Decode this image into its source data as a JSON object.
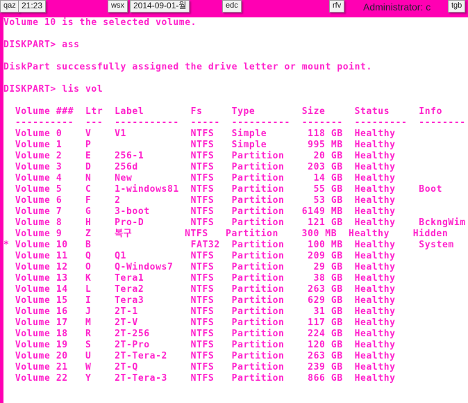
{
  "taskbar": {
    "chips": [
      {
        "name": "chip-qaz",
        "label": "qaz"
      },
      {
        "name": "chip-time",
        "label": "21:23"
      },
      {
        "name": "chip-wsx",
        "label": "wsx"
      },
      {
        "name": "chip-date",
        "label": "2014-09-01-월"
      },
      {
        "name": "chip-edc",
        "label": "edc"
      },
      {
        "name": "chip-rfv",
        "label": "rfv"
      },
      {
        "name": "chip-tgb",
        "label": "tgb"
      }
    ],
    "window_title": "Administrator: c",
    "band_color": "#ff00b3"
  },
  "console": {
    "background_color": "#ffffff",
    "text_color": "#ff22cc",
    "preamble": [
      "Volume 10 is the selected volume.",
      "",
      "DISKPART> ass",
      "",
      "DiskPart successfully assigned the drive letter or mount point.",
      "",
      "DISKPART> lis vol",
      ""
    ],
    "table": {
      "headers": [
        "Volume ###",
        "Ltr",
        "Label",
        "Fs",
        "Type",
        "Size",
        "Status",
        "Info"
      ],
      "separator": "  ----------  ---  -----------  -----  ----------  -------  ---------  --------",
      "rows": [
        {
          "marker": " ",
          "volume": "Volume 0",
          "ltr": "V",
          "label": "V1",
          "fs": "NTFS",
          "type": "Simple",
          "size": "118 GB",
          "status": "Healthy",
          "info": ""
        },
        {
          "marker": " ",
          "volume": "Volume 1",
          "ltr": "P",
          "label": "",
          "fs": "NTFS",
          "type": "Simple",
          "size": "995 MB",
          "status": "Healthy",
          "info": ""
        },
        {
          "marker": " ",
          "volume": "Volume 2",
          "ltr": "E",
          "label": "256-1",
          "fs": "NTFS",
          "type": "Partition",
          "size": "20 GB",
          "status": "Healthy",
          "info": ""
        },
        {
          "marker": " ",
          "volume": "Volume 3",
          "ltr": "D",
          "label": "256d",
          "fs": "NTFS",
          "type": "Partition",
          "size": "203 GB",
          "status": "Healthy",
          "info": ""
        },
        {
          "marker": " ",
          "volume": "Volume 4",
          "ltr": "N",
          "label": "New",
          "fs": "NTFS",
          "type": "Partition",
          "size": "14 GB",
          "status": "Healthy",
          "info": ""
        },
        {
          "marker": " ",
          "volume": "Volume 5",
          "ltr": "C",
          "label": "1-windows81",
          "fs": "NTFS",
          "type": "Partition",
          "size": "55 GB",
          "status": "Healthy",
          "info": "Boot"
        },
        {
          "marker": " ",
          "volume": "Volume 6",
          "ltr": "F",
          "label": "2",
          "fs": "NTFS",
          "type": "Partition",
          "size": "53 GB",
          "status": "Healthy",
          "info": ""
        },
        {
          "marker": " ",
          "volume": "Volume 7",
          "ltr": "G",
          "label": "3-boot",
          "fs": "NTFS",
          "type": "Partition",
          "size": "6149 MB",
          "status": "Healthy",
          "info": ""
        },
        {
          "marker": " ",
          "volume": "Volume 8",
          "ltr": "H",
          "label": "Pro-D",
          "fs": "NTFS",
          "type": "Partition",
          "size": "121 GB",
          "status": "Healthy",
          "info": "BckngWim"
        },
        {
          "marker": " ",
          "volume": "Volume 9",
          "ltr": "Z",
          "label": "복구",
          "fs": "NTFS",
          "type": "Partition",
          "size": "300 MB",
          "status": "Healthy",
          "info": "Hidden"
        },
        {
          "marker": "*",
          "volume": "Volume 10",
          "ltr": "B",
          "label": "",
          "fs": "FAT32",
          "type": "Partition",
          "size": "100 MB",
          "status": "Healthy",
          "info": "System"
        },
        {
          "marker": " ",
          "volume": "Volume 11",
          "ltr": "Q",
          "label": "Q1",
          "fs": "NTFS",
          "type": "Partition",
          "size": "209 GB",
          "status": "Healthy",
          "info": ""
        },
        {
          "marker": " ",
          "volume": "Volume 12",
          "ltr": "O",
          "label": "Q-Windows7",
          "fs": "NTFS",
          "type": "Partition",
          "size": "29 GB",
          "status": "Healthy",
          "info": ""
        },
        {
          "marker": " ",
          "volume": "Volume 13",
          "ltr": "K",
          "label": "Tera1",
          "fs": "NTFS",
          "type": "Partition",
          "size": "38 GB",
          "status": "Healthy",
          "info": ""
        },
        {
          "marker": " ",
          "volume": "Volume 14",
          "ltr": "L",
          "label": "Tera2",
          "fs": "NTFS",
          "type": "Partition",
          "size": "263 GB",
          "status": "Healthy",
          "info": ""
        },
        {
          "marker": " ",
          "volume": "Volume 15",
          "ltr": "I",
          "label": "Tera3",
          "fs": "NTFS",
          "type": "Partition",
          "size": "629 GB",
          "status": "Healthy",
          "info": ""
        },
        {
          "marker": " ",
          "volume": "Volume 16",
          "ltr": "J",
          "label": "2T-1",
          "fs": "NTFS",
          "type": "Partition",
          "size": "31 GB",
          "status": "Healthy",
          "info": ""
        },
        {
          "marker": " ",
          "volume": "Volume 17",
          "ltr": "M",
          "label": "2T-V",
          "fs": "NTFS",
          "type": "Partition",
          "size": "117 GB",
          "status": "Healthy",
          "info": ""
        },
        {
          "marker": " ",
          "volume": "Volume 18",
          "ltr": "R",
          "label": "2T-256",
          "fs": "NTFS",
          "type": "Partition",
          "size": "224 GB",
          "status": "Healthy",
          "info": ""
        },
        {
          "marker": " ",
          "volume": "Volume 19",
          "ltr": "S",
          "label": "2T-Pro",
          "fs": "NTFS",
          "type": "Partition",
          "size": "120 GB",
          "status": "Healthy",
          "info": ""
        },
        {
          "marker": " ",
          "volume": "Volume 20",
          "ltr": "U",
          "label": "2T-Tera-2",
          "fs": "NTFS",
          "type": "Partition",
          "size": "263 GB",
          "status": "Healthy",
          "info": ""
        },
        {
          "marker": " ",
          "volume": "Volume 21",
          "ltr": "W",
          "label": "2T-Q",
          "fs": "NTFS",
          "type": "Partition",
          "size": "239 GB",
          "status": "Healthy",
          "info": ""
        },
        {
          "marker": " ",
          "volume": "Volume 22",
          "ltr": "Y",
          "label": "2T-Tera-3",
          "fs": "NTFS",
          "type": "Partition",
          "size": "866 GB",
          "status": "Healthy",
          "info": ""
        }
      ]
    }
  }
}
